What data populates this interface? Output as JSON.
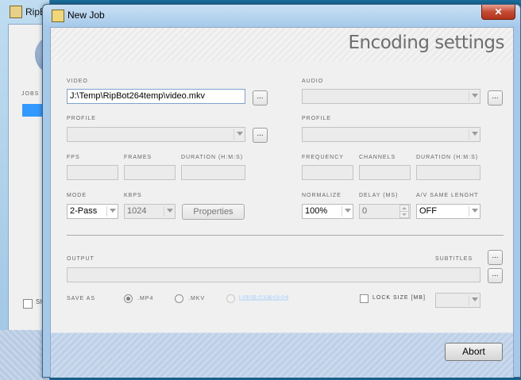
{
  "bg_window": {
    "title": "RipB",
    "jobs_label": "JOBS",
    "checkbox_label": "SH"
  },
  "dialog": {
    "title": "New Job",
    "close_label": "✕",
    "heading": "Encoding settings"
  },
  "video": {
    "label": "VIDEO",
    "path_value": "J:\\Temp\\RipBot264temp\\video.mkv",
    "browse_label": "...",
    "profile_label": "PROFILE",
    "profile_value": "",
    "profile_button_label": "...",
    "fps_label": "FPS",
    "frames_label": "FRAMES",
    "duration_label": "DURATION (H:M:S)",
    "mode_label": "MODE",
    "mode_value": "2-Pass",
    "kbps_label": "KBPS",
    "kbps_value": "1024",
    "properties_label": "Properties"
  },
  "audio": {
    "label": "AUDIO",
    "value": "",
    "browse_label": "...",
    "profile_label": "PROFILE",
    "profile_value": "",
    "frequency_label": "FREQUENCY",
    "channels_label": "CHANNELS",
    "duration_label": "DURATION (H:M:S)",
    "normalize_label": "NORMALIZE",
    "normalize_value": "100%",
    "delay_label": "DELAY (MS)",
    "delay_value": "0",
    "av_same_length_label": "A/V SAME LENGHT",
    "av_same_length_value": "OFF"
  },
  "output": {
    "label": "OUTPUT",
    "subtitles_label": "SUBTITLES",
    "subtitles_button_label": "...",
    "output_button_label": "...",
    "save_as_label": "SAVE AS",
    "formats": [
      {
        "label": ".MP4",
        "checked": true
      },
      {
        "label": ".MKV",
        "checked": false
      },
      {
        "label": "BLU-RAY DISC",
        "checked": false
      }
    ],
    "lock_size_label": "LOCK SIZE [MB]",
    "lock_size_value": ""
  },
  "footer": {
    "abort_label": "Abort"
  }
}
